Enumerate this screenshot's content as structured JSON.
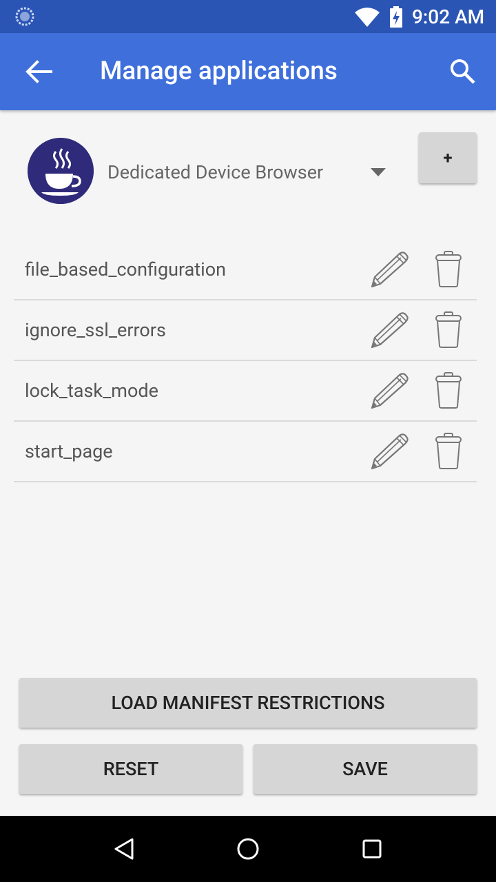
{
  "status_bar": {
    "time": "9:02 AM",
    "icons": [
      "sync-icon",
      "wifi-icon",
      "battery-charging-icon"
    ]
  },
  "app_bar": {
    "title": "Manage applications",
    "back_icon": "arrow-back-icon",
    "search_icon": "search-icon"
  },
  "app_selector": {
    "icon": "coffee-cup-icon",
    "selected_app": "Dedicated Device Browser",
    "add_label": "+"
  },
  "restrictions": [
    {
      "key": "file_based_configuration"
    },
    {
      "key": "ignore_ssl_errors"
    },
    {
      "key": "lock_task_mode"
    },
    {
      "key": "start_page"
    }
  ],
  "buttons": {
    "load": "LOAD MANIFEST RESTRICTIONS",
    "reset": "RESET",
    "save": "SAVE"
  },
  "colors": {
    "status_bar": "#2a55b4",
    "app_bar": "#3f6fdb",
    "app_icon_bg": "#2f2b7a"
  }
}
